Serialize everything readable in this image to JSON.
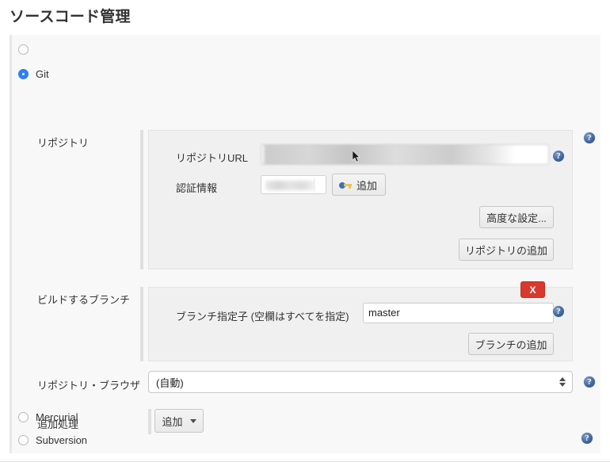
{
  "page": {
    "title": "ソースコード管理"
  },
  "scm_options": [
    {
      "id": "none",
      "label": "",
      "checked": false
    },
    {
      "id": "git",
      "label": "Git",
      "checked": true
    },
    {
      "id": "mercurial",
      "label": "Mercurial",
      "checked": false
    },
    {
      "id": "subversion",
      "label": "Subversion",
      "checked": false
    }
  ],
  "git": {
    "repositories": {
      "label": "リポジトリ",
      "url_label": "リポジトリURL",
      "url_value": "",
      "url_placeholder": "",
      "credentials_label": "認証情報",
      "credentials_value": "",
      "add_credentials_button": "追加",
      "advanced_button": "高度な設定...",
      "add_repository_button": "リポジトリの追加"
    },
    "branches": {
      "label": "ビルドするブランチ",
      "spec_label": "ブランチ指定子 (空欄はすべてを指定)",
      "spec_value": "master",
      "delete_button": "X",
      "add_branch_button": "ブランチの追加"
    },
    "browser": {
      "label": "リポジトリ・ブラウザ",
      "selected": "(自動)"
    },
    "extensions": {
      "label": "追加処理",
      "add_button": "追加"
    }
  },
  "help": {
    "glyph": "?"
  },
  "colors": {
    "accent": "#2d7ff9",
    "danger": "#d9382c",
    "help_icon": "#43679c",
    "panel_bg": "#f0f0f0",
    "block_bg": "#f8f8f8"
  }
}
